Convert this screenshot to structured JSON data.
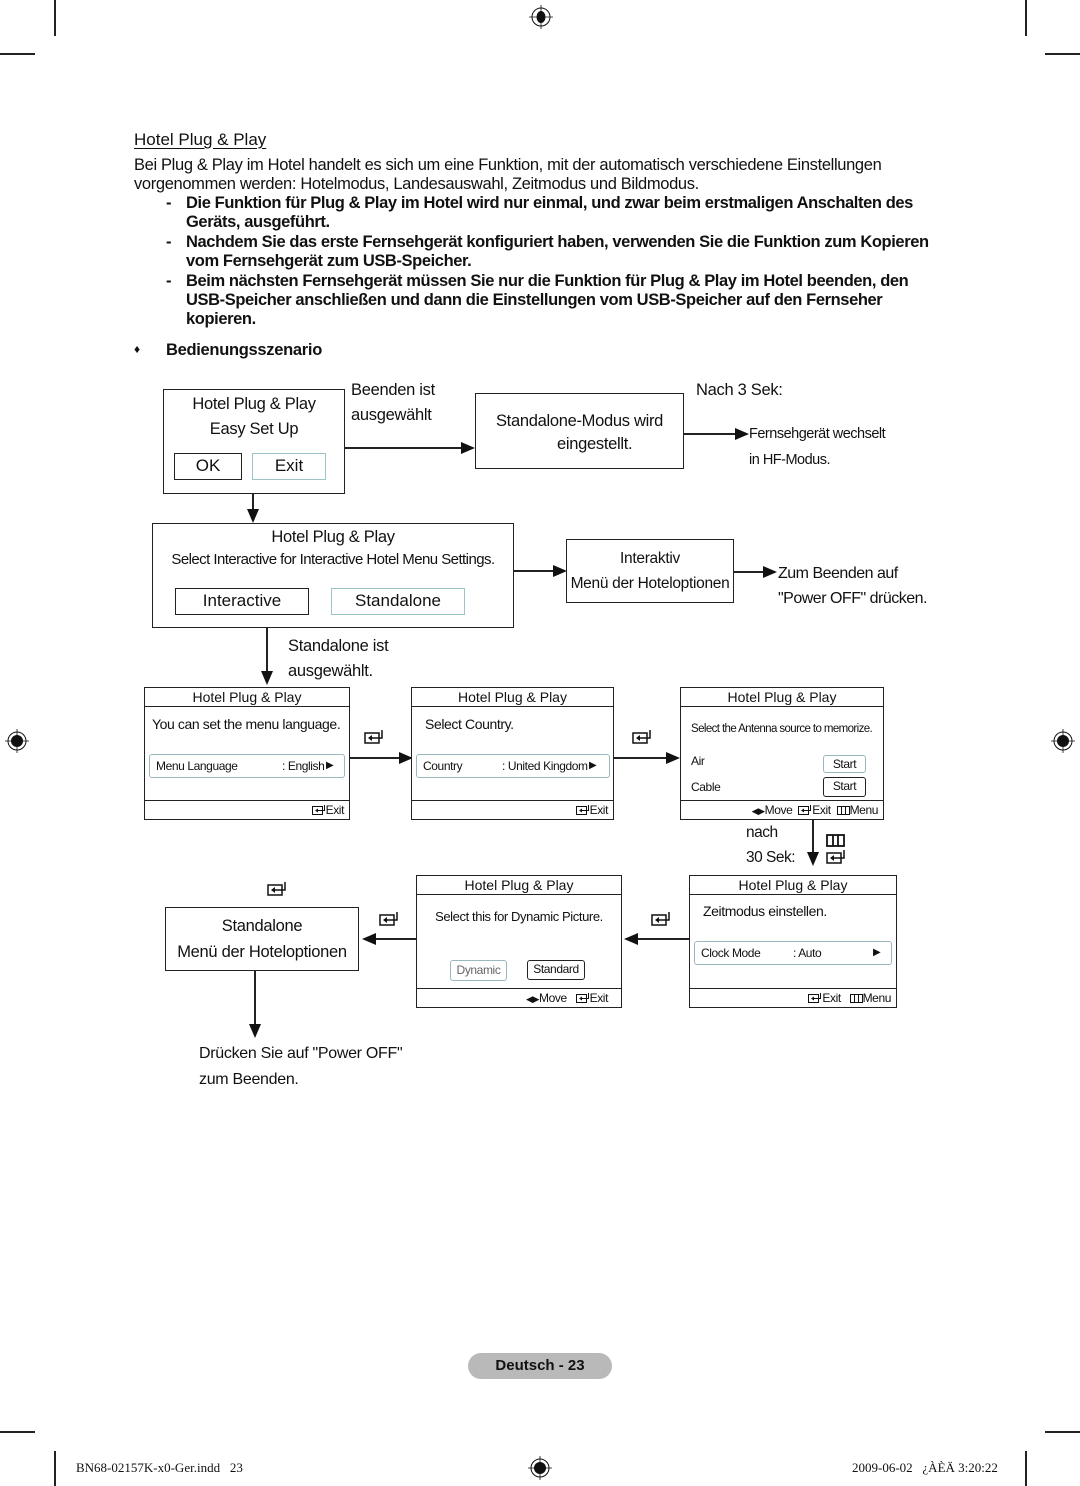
{
  "document": {
    "section_title": "Hotel Plug & Play",
    "intro": "Bei Plug & Play im Hotel handelt es sich um eine Funktion, mit der automatisch verschiedene Einstellungen vorgenommen werden: Hotelmodus, Landesauswahl, Zeitmodus und Bildmodus.",
    "bullets": [
      "Die Funktion für Plug & Play im Hotel wird nur einmal, und zwar beim erstmaligen Anschalten des Geräts, ausgeführt.",
      "Nachdem Sie das erste Fernsehgerät konfiguriert haben, verwenden Sie die Funktion zum Kopieren vom Fernsehgerät zum USB-Speicher.",
      "Beim nächsten Fernsehgerät müssen Sie nur die Funktion für Plug & Play im Hotel beenden, den USB-Speicher anschließen und dann die Einstellungen vom USB-Speicher auf den Fernseher kopieren."
    ],
    "bullet_dash": "-",
    "scenario_marker": "♦",
    "scenario_title": "Bedienungsszenario"
  },
  "diagram": {
    "easy_setup": {
      "title": "Hotel Plug & Play",
      "subtitle": "Easy Set Up",
      "ok_label": "OK",
      "exit_label": "Exit"
    },
    "exit_selected_label": [
      "Beenden ist",
      "ausgewählt"
    ],
    "standalone_set_box": [
      "Standalone-Modus wird",
      "eingestellt."
    ],
    "after_3_sec": "Nach 3 Sek:",
    "tv_switches": [
      "Fernsehgerät wechselt",
      "in HF-Modus."
    ],
    "mode_select": {
      "title": "Hotel Plug & Play",
      "message": "Select Interactive for Interactive Hotel Menu Settings.",
      "interactive_label": "Interactive",
      "standalone_label": "Standalone"
    },
    "interactive_box": [
      "Interaktiv",
      "Menü der Hoteloptionen"
    ],
    "to_exit_note": [
      "Zum Beenden auf",
      "\"Power OFF\" drücken."
    ],
    "standalone_selected_label": [
      "Standalone ist",
      "ausgewählt."
    ],
    "osd_language": {
      "title": "Hotel Plug & Play",
      "message": "You can set the menu language.",
      "field_key": "Menu Language",
      "field_value": ": English",
      "footer_exit": "Exit"
    },
    "osd_country": {
      "title": "Hotel Plug & Play",
      "message": "Select Country.",
      "field_key": "Country",
      "field_value": ": United Kingdom",
      "footer_exit": "Exit"
    },
    "osd_antenna": {
      "title": "Hotel Plug & Play",
      "message": "Select the Antenna source to memorize.",
      "rows": [
        {
          "label": "Air",
          "button": "Start"
        },
        {
          "label": "Cable",
          "button": "Start"
        }
      ],
      "footer_move": "Move",
      "footer_exit": "Exit",
      "footer_menu": "Menu"
    },
    "after_30_sec": [
      "nach",
      "30 Sek:"
    ],
    "osd_clock": {
      "title": "Hotel Plug & Play",
      "message": "Zeitmodus einstellen.",
      "field_key": "Clock Mode",
      "field_value": ": Auto",
      "footer_exit": "Exit",
      "footer_menu": "Menu"
    },
    "osd_picture": {
      "title": "Hotel Plug & Play",
      "message": "Select this for Dynamic Picture.",
      "dynamic_label": "Dynamic",
      "standard_label": "Standard",
      "footer_move": "Move",
      "footer_exit": "Exit"
    },
    "standalone_menu_box": [
      "Standalone",
      "Menü der Hoteloptionen"
    ],
    "power_off_note": [
      "Drücken Sie auf \"Power OFF\"",
      "zum Beenden."
    ]
  },
  "footer": {
    "page_label": "Deutsch - 23",
    "file_name": "BN68-02157K-x0-Ger.indd   23",
    "timestamp": "2009-06-02   ¿ÀÈÄ 3:20:22"
  }
}
